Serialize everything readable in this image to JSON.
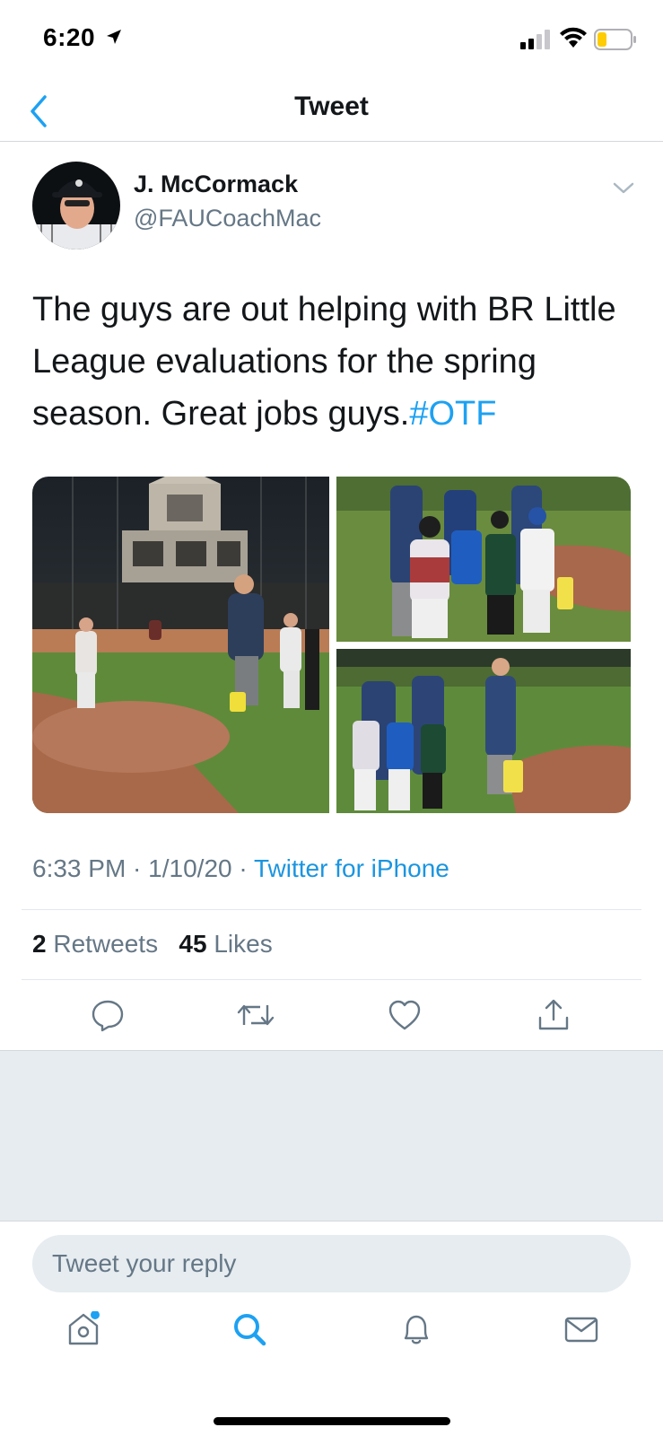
{
  "status_bar": {
    "time": "6:20",
    "icons": [
      "location-arrow-icon",
      "signal-icon",
      "wifi-icon",
      "battery-icon"
    ]
  },
  "nav": {
    "title": "Tweet",
    "back_icon": "chevron-left-icon"
  },
  "tweet": {
    "author": {
      "display_name": "J. McCormack",
      "handle": "@FAUCoachMac"
    },
    "text": "The guys are out helping with BR Little League evaluations for the spring season. Great jobs guys.",
    "hashtag": "#OTF",
    "meta": {
      "time": "6:33 PM",
      "date": "1/10/20",
      "source": "Twitter for iPhone",
      "separator": " · "
    },
    "stats": {
      "retweets_count": "2",
      "retweets_label": "Retweets",
      "likes_count": "45",
      "likes_label": "Likes"
    },
    "actions": [
      "reply-icon",
      "retweet-icon",
      "like-icon",
      "share-icon"
    ]
  },
  "reply": {
    "placeholder": "Tweet your reply"
  },
  "tab_bar": {
    "tabs": [
      "home-icon",
      "search-icon",
      "notifications-icon",
      "messages-icon"
    ],
    "active": "search-icon"
  },
  "colors": {
    "accent": "#1da1f2",
    "text": "#14171a",
    "secondary": "#657786",
    "divider": "#e1e8ed",
    "gray_bg": "#e6ecf0"
  }
}
